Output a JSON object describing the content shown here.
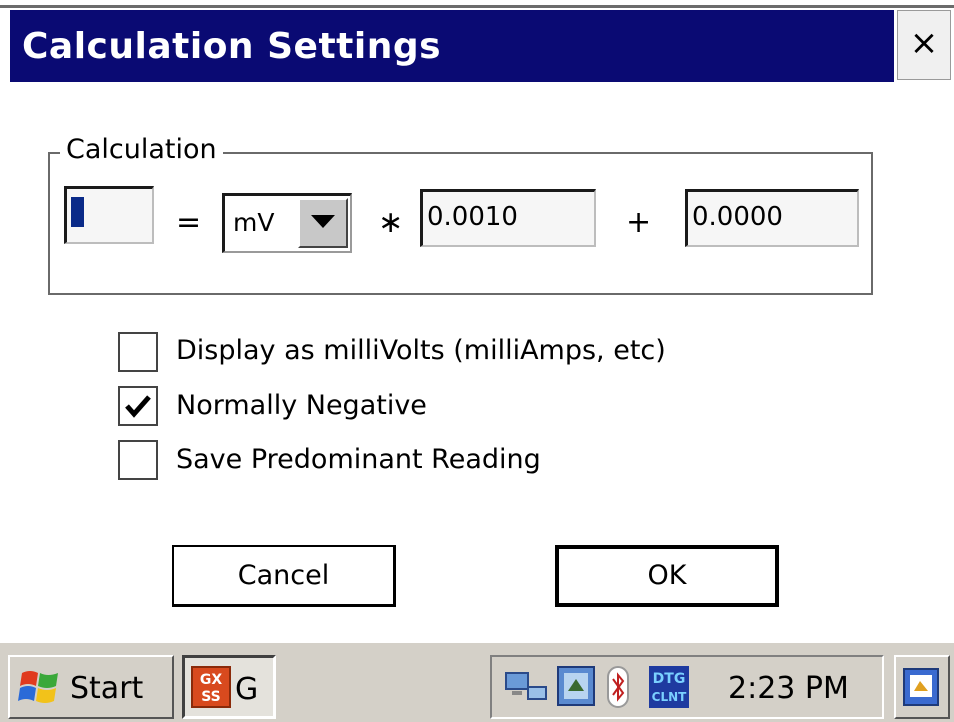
{
  "window": {
    "title": "Calculation Settings",
    "close_label": "×"
  },
  "calculation": {
    "group_label": "Calculation",
    "equals": "=",
    "multiply": "∗",
    "plus": "+",
    "unit_select": {
      "value": "mV"
    },
    "multiplier": "0.0010",
    "offset": "0.0000"
  },
  "options": [
    {
      "label": "Display as milliVolts (milliAmps, etc)",
      "checked": false
    },
    {
      "label": "Normally Negative",
      "checked": true
    },
    {
      "label": "Save Predominant Reading",
      "checked": false
    }
  ],
  "buttons": {
    "cancel": "Cancel",
    "ok": "OK"
  },
  "taskbar": {
    "start_label": "Start",
    "task_label": "G",
    "task_icon_text": "GX SS",
    "tray_icon_text": "DTG CLNT",
    "clock": "2:23 PM"
  },
  "colors": {
    "title_bar": "#0a0a73",
    "taskbar": "#d4d0c8"
  }
}
